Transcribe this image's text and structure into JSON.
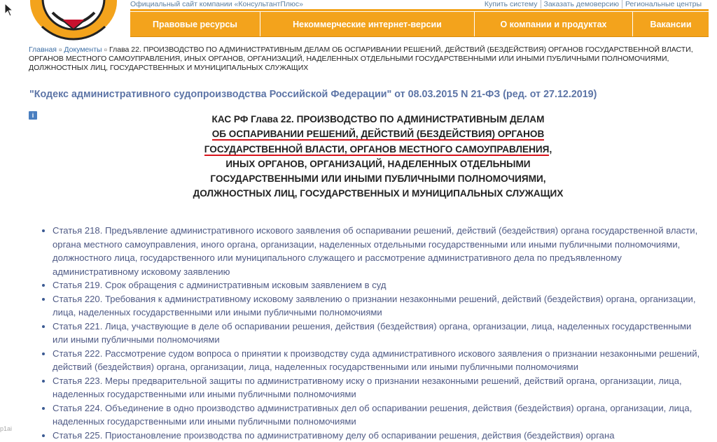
{
  "colors": {
    "nav_bg": "#f3a31c",
    "link": "#3d6ea4",
    "title": "#5c74a6",
    "underline": "#d9141b"
  },
  "topbar": {
    "site_name": "Официальный сайт компании «КонсультантПлюс»",
    "links": [
      "Купить систему",
      "Заказать демоверсию",
      "Региональные центры"
    ]
  },
  "nav": {
    "items": [
      "Правовые ресурсы",
      "Некоммерческие интернет-версии",
      "О компании и продуктах",
      "Вакансии"
    ]
  },
  "breadcrumb": {
    "home": "Главная",
    "docs": "Документы",
    "current": "Глава 22. ПРОИЗВОДСТВО ПО АДМИНИСТРАТИВНЫМ ДЕЛАМ ОБ ОСПАРИВАНИИ РЕШЕНИЙ, ДЕЙСТВИЙ (БЕЗДЕЙСТВИЯ) ОРГАНОВ ГОСУДАРСТВЕННОЙ ВЛАСТИ, ОРГАНОВ МЕСТНОГО САМОУПРАВЛЕНИЯ, ИНЫХ ОРГАНОВ, ОРГАНИЗАЦИЙ, НАДЕЛЕННЫХ ОТДЕЛЬНЫМИ ГОСУДАРСТВЕННЫМИ ИЛИ ИНЫМИ ПУБЛИЧНЫМИ ПОЛНОМОЧИЯМИ, ДОЛЖНОСТНЫХ ЛИЦ, ГОСУДАРСТВЕННЫХ И МУНИЦИПАЛЬНЫХ СЛУЖАЩИХ"
  },
  "document": {
    "title": "\"Кодекс административного судопроизводства Российской Федерации\" от 08.03.2015 N 21-ФЗ (ред. от 27.12.2019)",
    "info_badge": "i",
    "chapter": {
      "line1": "КАС РФ Глава 22. ПРОИЗВОДСТВО ПО АДМИНИСТРАТИВНЫМ ДЕЛАМ",
      "line2": "ОБ ОСПАРИВАНИИ РЕШЕНИЙ, ДЕЙСТВИЙ (БЕЗДЕЙСТВИЯ) ОРГАНОВ",
      "line3": "ГОСУДАРСТВЕННОЙ ВЛАСТИ, ОРГАНОВ МЕСТНОГО САМОУПРАВЛЕНИЯ",
      "line3_tail": ",",
      "line4": "ИНЫХ ОРГАНОВ, ОРГАНИЗАЦИЙ, НАДЕЛЕННЫХ ОТДЕЛЬНЫМИ",
      "line5": "ГОСУДАРСТВЕННЫМИ ИЛИ ИНЫМИ ПУБЛИЧНЫМИ ПОЛНОМОЧИЯМИ,",
      "line6": "ДОЛЖНОСТНЫХ ЛИЦ, ГОСУДАРСТВЕННЫХ И МУНИЦИПАЛЬНЫХ СЛУЖАЩИХ"
    },
    "articles": [
      "Статья 218. Предъявление административного искового заявления об оспаривании решений, действий (бездействия) органа государственной власти, органа местного самоуправления, иного органа, организации, наделенных отдельными государственными или иными публичными полномочиями, должностного лица, государственного или муниципального служащего и рассмотрение административного дела по предъявленному административному исковому заявлению",
      "Статья 219. Срок обращения с административным исковым заявлением в суд",
      "Статья 220. Требования к административному исковому заявлению о признании незаконными решений, действий (бездействия) органа, организации, лица, наделенных государственными или иными публичными полномочиями",
      "Статья 221. Лица, участвующие в деле об оспаривании решения, действия (бездействия) органа, организации, лица, наделенных государственными или иными публичными полномочиями",
      "Статья 222. Рассмотрение судом вопроса о принятии к производству суда административного искового заявления о признании незаконными решений, действий (бездействия) органа, организации, лица, наделенных государственными или иными публичными полномочиями",
      "Статья 223. Меры предварительной защиты по административному иску о признании незаконными решений, действий органа, организации, лица, наделенных государственными или иными публичными полномочиями",
      "Статья 224. Объединение в одно производство административных дел об оспаривании решения, действия (бездействия) органа, организации, лица, наделенных государственными или иными публичными полномочиями",
      "Статья 225. Приостановление производства по административному делу об оспаривании решения, действия (бездействия) органа"
    ]
  },
  "corner_tag": "p1ai"
}
